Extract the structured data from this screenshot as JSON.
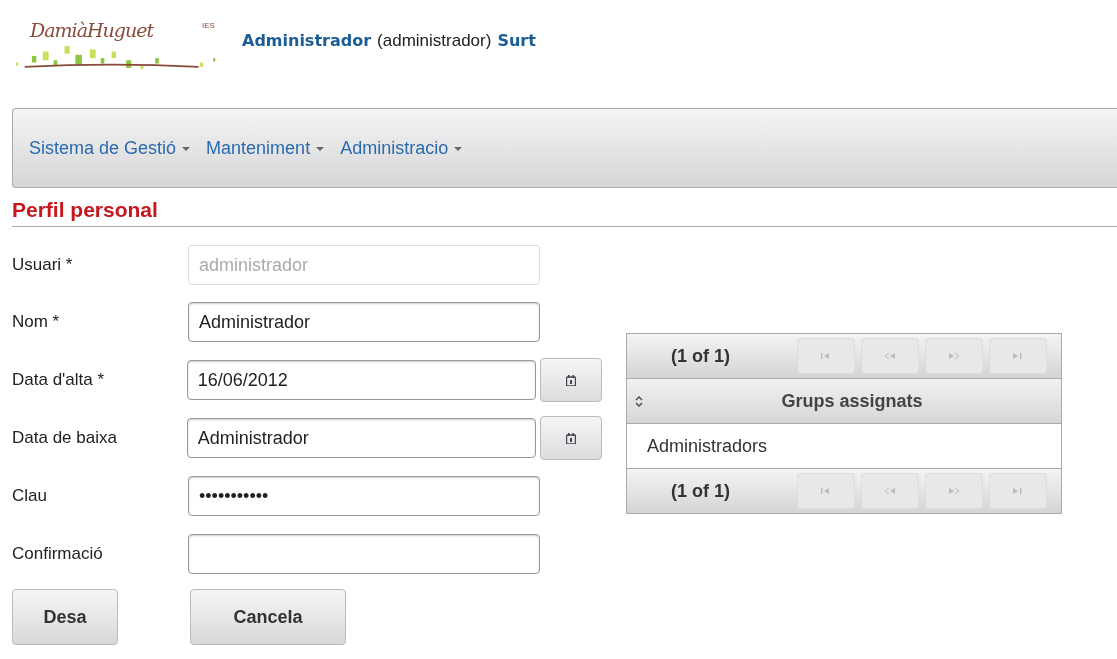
{
  "logo": {
    "signature": "DamiàHuguet",
    "school": "IES"
  },
  "user": {
    "name": "Administrador",
    "login": "(administrador)",
    "logout": "Surt"
  },
  "menu": [
    {
      "label": "Sistema de Gestió"
    },
    {
      "label": "Manteniment"
    },
    {
      "label": "Administracio"
    }
  ],
  "page_title": "Perfil personal",
  "form": [
    {
      "label": "Usuari *",
      "value": "administrador",
      "disabled": true,
      "calendar": false
    },
    {
      "label": "Nom *",
      "value": "Administrador",
      "disabled": false,
      "calendar": false
    },
    {
      "label": "Data d'alta *",
      "value": "16/06/2012",
      "disabled": false,
      "calendar": true
    },
    {
      "label": "Data de baixa",
      "value": "Administrador",
      "disabled": false,
      "calendar": true
    },
    {
      "label": "Clau",
      "value": "•••••••••••",
      "disabled": false,
      "calendar": false
    },
    {
      "label": "Confirmació",
      "disabled": false,
      "calendar": false
    }
  ],
  "buttons": [
    "Desa",
    "Cancela"
  ],
  "groups_table": {
    "paginator_top": "(1 of 1)",
    "column": "Grups assignats",
    "rows": [
      "Administradors"
    ],
    "paginator_bottom": "(1 of 1)"
  }
}
